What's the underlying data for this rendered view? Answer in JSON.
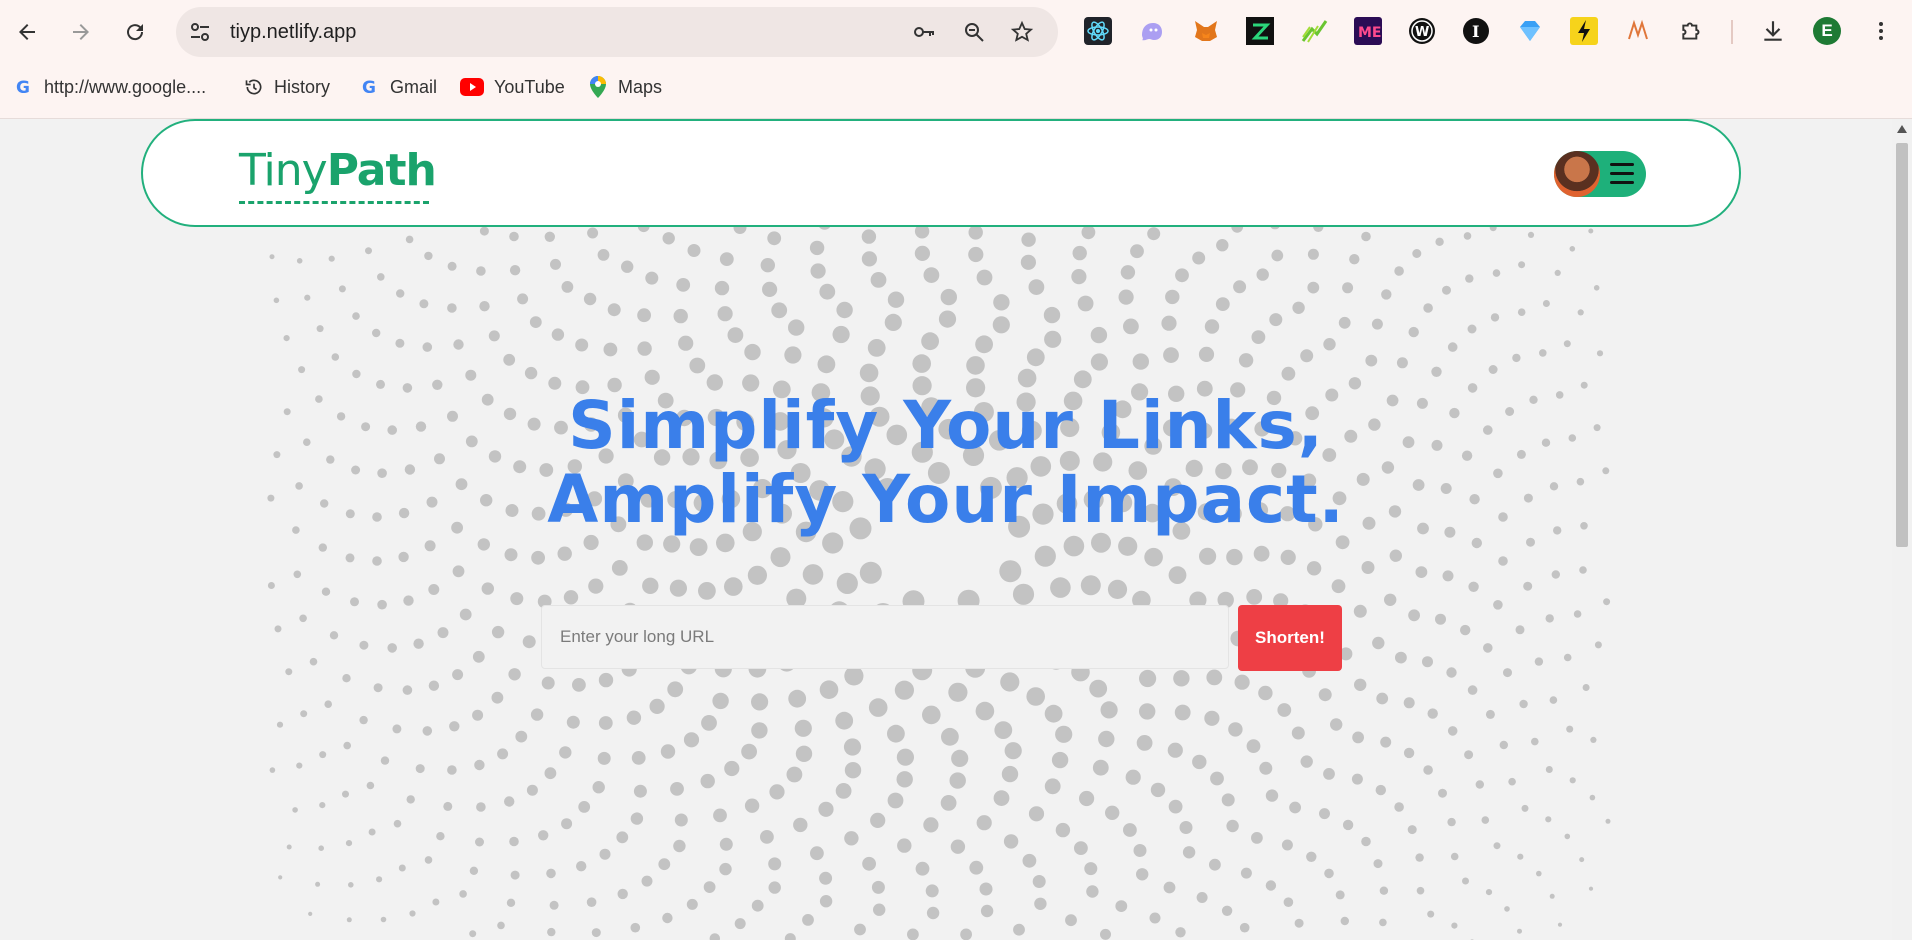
{
  "browser": {
    "url": "tiyp.netlify.app",
    "bookmarks": [
      {
        "label": "http://www.google....",
        "icon": "google-icon"
      },
      {
        "label": "History",
        "icon": "history-icon"
      },
      {
        "label": "Gmail",
        "icon": "google-icon"
      },
      {
        "label": "YouTube",
        "icon": "youtube-icon"
      },
      {
        "label": "Maps",
        "icon": "maps-icon"
      }
    ],
    "profile_initial": "E",
    "extension_icons": [
      "react-devtools-icon",
      "ghost-icon",
      "metamask-icon",
      "z-extension-icon",
      "chart-extension-icon",
      "me-extension-icon",
      "w-extension-icon",
      "i-extension-icon",
      "diamond-extension-icon",
      "bolt-extension-icon",
      "n-extension-icon",
      "puzzle-icon"
    ],
    "colors": {
      "chrome_bg": "#fdf4f2",
      "omnibox_bg": "#efe6e4",
      "profile": "#1e7a34"
    }
  },
  "site": {
    "logo": {
      "part1": "Tiny",
      "part2": "Path"
    },
    "headline": {
      "line1": "Simplify Your Links,",
      "line2": "Amplify Your Impact."
    },
    "input": {
      "placeholder": "Enter your long URL",
      "value": ""
    },
    "shorten_label": "Shorten!",
    "colors": {
      "brand_green": "#1eb07a",
      "headline_blue": "#3a7fea",
      "button_red": "#ee3f45",
      "dot_gray": "#c3c3c3"
    }
  }
}
